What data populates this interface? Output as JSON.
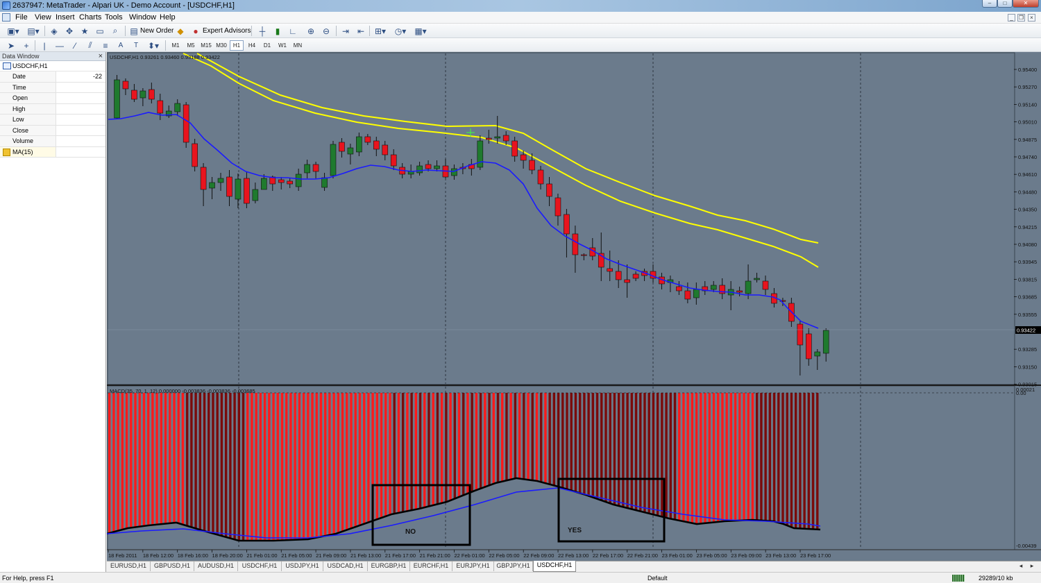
{
  "window": {
    "title": "2637947: MetaTrader - Alpari UK - Demo Account - [USDCHF,H1]"
  },
  "menu": [
    "File",
    "View",
    "Insert",
    "Charts",
    "Tools",
    "Window",
    "Help"
  ],
  "toolbar": {
    "new_order": "New Order",
    "expert_advisors": "Expert Advisors"
  },
  "timeframes": [
    "M1",
    "M5",
    "M15",
    "M30",
    "H1",
    "H4",
    "D1",
    "W1",
    "MN"
  ],
  "active_timeframe": "H1",
  "data_window": {
    "title": "Data Window",
    "symbol": "USDCHF,H1",
    "rows": [
      {
        "key": "Date",
        "value": "-22"
      },
      {
        "key": "Time",
        "value": ""
      },
      {
        "key": "Open",
        "value": ""
      },
      {
        "key": "High",
        "value": ""
      },
      {
        "key": "Low",
        "value": ""
      },
      {
        "key": "Close",
        "value": ""
      },
      {
        "key": "Volume",
        "value": ""
      }
    ],
    "indicator": "MA(15)"
  },
  "chart": {
    "header": "USDCHF,H1  0.93261 0.93460 0.93188 0.93422",
    "current_price": "0.93422",
    "price_labels": [
      "0.95400",
      "0.95270",
      "0.95140",
      "0.95010",
      "0.94875",
      "0.94740",
      "0.94610",
      "0.94480",
      "0.94350",
      "0.94215",
      "0.94080",
      "0.93945",
      "0.93815",
      "0.93685",
      "0.93555",
      "0.93285",
      "0.93150",
      "0.93015"
    ],
    "time_labels": [
      "18 Feb 2011",
      "18 Feb 12:00",
      "18 Feb 16:00",
      "18 Feb 20:00",
      "21 Feb 01:00",
      "21 Feb 05:00",
      "21 Feb 09:00",
      "21 Feb 13:00",
      "21 Feb 17:00",
      "21 Feb 21:00",
      "22 Feb 01:00",
      "22 Feb 05:00",
      "22 Feb 09:00",
      "22 Feb 13:00",
      "22 Feb 17:00",
      "22 Feb 21:00",
      "23 Feb 01:00",
      "23 Feb 05:00",
      "23 Feb 09:00",
      "23 Feb 13:00",
      "23 Feb 17:00"
    ],
    "macd_header": "MACD(35, 70, 1, 12) 0.000000 -0.003836 -0.003836 -0.003685",
    "macd_labels": [
      "0.00021",
      "0.00",
      "-0.00439"
    ],
    "annotations": [
      "NO",
      "YES"
    ],
    "colors": {
      "background": "#6b7b8c",
      "bull": "#1f7a2e",
      "bear": "#e8141e",
      "ma": "#1a1aff",
      "bands": "#ffff00",
      "macd_light": "#ff1a1a",
      "macd_dark": "#7a0a0a"
    }
  },
  "tabs": [
    "EURUSD,H1",
    "GBPUSD,H1",
    "AUDUSD,H1",
    "USDCHF,H1",
    "USDJPY,H1",
    "USDCAD,H1",
    "EURGBP,H1",
    "EURCHF,H1",
    "EURJPY,H1",
    "GBPJPY,H1",
    "USDCHF,H1"
  ],
  "active_tab": 10,
  "status": {
    "help": "For Help, press F1",
    "profile": "Default",
    "traffic": "29289/10 kb"
  }
}
